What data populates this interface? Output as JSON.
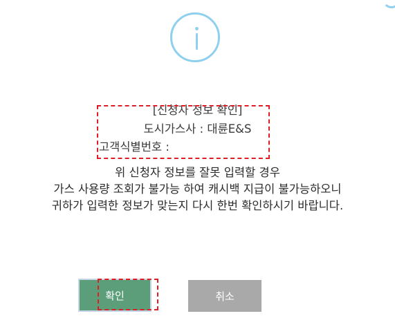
{
  "dialog": {
    "applicant_info": {
      "title": "[신청자 정보 확인]",
      "gas_company": "도시가스사 : 대륜E&S",
      "customer_id": "고객식별번호 :"
    },
    "warning_lines": [
      "위 신청자 정보를 잘못 입력할 경우",
      "가스 사용량 조회가 불가능 하여 캐시백 지급이 불가능하오니",
      "귀하가 입력한 정보가 맞는지 다시 한번 확인하시기 바랍니다."
    ],
    "buttons": {
      "confirm": "확인",
      "cancel": "취소"
    }
  },
  "icons": {
    "main": "info-icon",
    "corner": "close-arc-icon"
  },
  "colors": {
    "icon": "#8fd0ee",
    "confirm_bg": "#5b9e79",
    "cancel_bg": "#a9a9a9",
    "highlight": "#e01c24"
  }
}
